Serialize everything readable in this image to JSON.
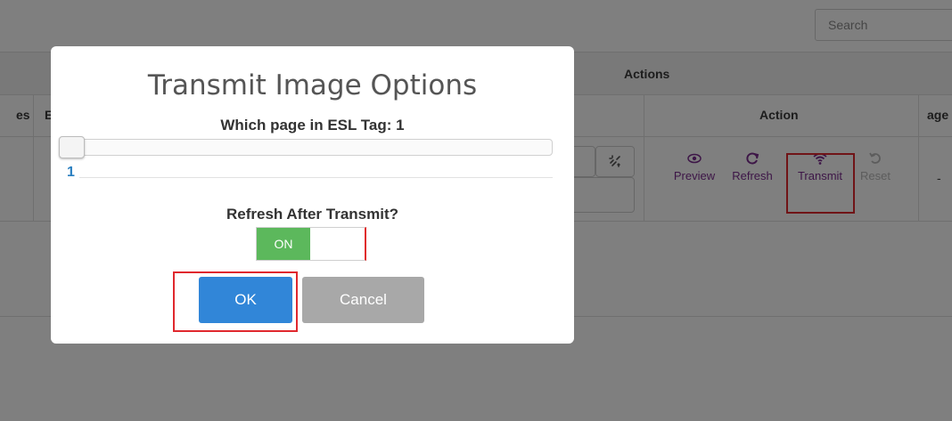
{
  "search": {
    "placeholder": "Search"
  },
  "table": {
    "group_header": "Actions",
    "headers": {
      "pages_partial": "es",
      "col_b_partial": "E",
      "action": "Action",
      "page_partial": "age"
    },
    "row": {
      "actions": [
        {
          "icon": "eye-icon",
          "label": "Preview"
        },
        {
          "icon": "refresh-icon",
          "label": "Refresh"
        },
        {
          "icon": "wifi-icon",
          "label": "Transmit"
        },
        {
          "icon": "undo-icon",
          "label": "Reset"
        }
      ],
      "last_cell": "-"
    }
  },
  "modal": {
    "title": "Transmit Image Options",
    "page_question": "Which page in ESL Tag: 1",
    "slider": {
      "value": "1",
      "min": 1,
      "max": 1
    },
    "refresh_question": "Refresh After Transmit?",
    "toggle": {
      "on_label": "ON",
      "state": "on"
    },
    "ok_label": "OK",
    "cancel_label": "Cancel"
  },
  "colors": {
    "primary": "#3186d8",
    "toggle_on": "#5cb85c",
    "highlight": "#e0282e",
    "action_link": "#7b2c8e"
  }
}
